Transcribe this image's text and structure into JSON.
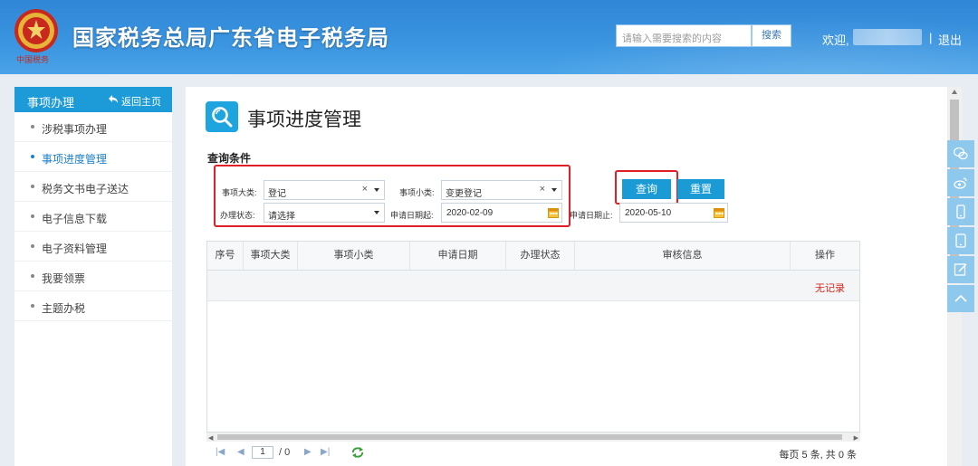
{
  "header": {
    "site_title": "国家税务总局广东省电子税务局",
    "emblem_caption": "中国税务",
    "search_placeholder": "请输入需要搜索的内容",
    "search_button": "搜索",
    "welcome": "欢迎,",
    "separator": "|",
    "logout": "退出"
  },
  "sidebar": {
    "title": "事项办理",
    "back_home": "返回主页",
    "items": [
      {
        "label": "涉税事项办理",
        "active": false
      },
      {
        "label": "事项进度管理",
        "active": true
      },
      {
        "label": "税务文书电子送达",
        "active": false
      },
      {
        "label": "电子信息下载",
        "active": false
      },
      {
        "label": "电子资料管理",
        "active": false
      },
      {
        "label": "我要领票",
        "active": false
      },
      {
        "label": "主题办税",
        "active": false
      }
    ]
  },
  "main": {
    "page_title": "事项进度管理",
    "query_title": "查询条件",
    "filters": {
      "category_label": "事项大类:",
      "category_value": "登记",
      "subcategory_label": "事项小类:",
      "subcategory_value": "变更登记",
      "status_label": "办理状态:",
      "status_value": "请选择",
      "date_from_label": "申请日期起:",
      "date_from_value": "2020-02-09",
      "date_to_label": "申请日期止:",
      "date_to_value": "2020-05-10",
      "clear_symbol": "×"
    },
    "buttons": {
      "query": "查询",
      "reset": "重置"
    },
    "table": {
      "columns": [
        "序号",
        "事项大类",
        "事项小类",
        "申请日期",
        "办理状态",
        "审核信息",
        "操作"
      ],
      "empty_text": "无记录"
    },
    "pager": {
      "current_page": "1",
      "total_pages": "/ 0",
      "summary": "每页 5 条, 共 0 条"
    }
  },
  "colors": {
    "header_blue": "#3b95e0",
    "accent": "#1a9bd6",
    "highlight_red": "#e01f26",
    "empty_red": "#d9261c"
  },
  "icons": {
    "page_icon": "magnifier-icon",
    "calendar": "calendar-icon",
    "back": "back-arrow-icon",
    "tools": [
      "wechat-icon",
      "weibo-icon",
      "mobile-icon",
      "tablet-icon",
      "edit-icon",
      "chevron-up-icon"
    ]
  }
}
